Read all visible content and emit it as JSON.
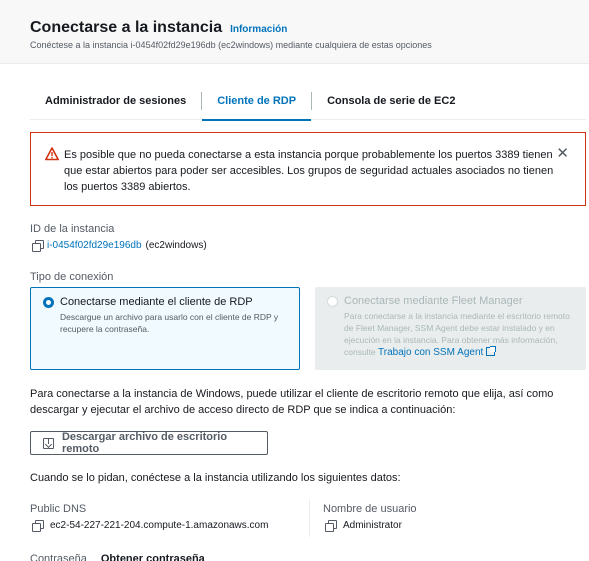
{
  "header": {
    "title": "Conectarse a la instancia",
    "info_link": "Información",
    "subtitle": "Conéctese a la instancia i-0454f02fd29e196db (ec2windows) mediante cualquiera de estas opciones"
  },
  "tabs": [
    {
      "label": "Administrador de sesiones",
      "active": false
    },
    {
      "label": "Cliente de RDP",
      "active": true
    },
    {
      "label": "Consola de serie de EC2",
      "active": false
    }
  ],
  "alert": {
    "text": "Es posible que no pueda conectarse a esta instancia porque probablemente los puertos 3389 tienen que estar abiertos para poder ser accesibles. Los grupos de seguridad actuales asociados no tienen los puertos 3389 abiertos.",
    "close_icon": "close-icon",
    "warning_icon": "warning-icon"
  },
  "instance": {
    "label": "ID de la instancia",
    "id": "i-0454f02fd29e196db",
    "name": "(ec2windows)"
  },
  "connection_type": {
    "label": "Tipo de conexión",
    "options": [
      {
        "title": "Conectarse mediante el cliente de RDP",
        "description": "Descargue un archivo para usarlo con el cliente de RDP y recupere la contraseña.",
        "selected": true,
        "disabled": false
      },
      {
        "title": "Conectarse mediante Fleet Manager",
        "description": "Para conectarse a la instancia mediante el escritorio remoto de Fleet Manager, SSM Agent debe estar instalado y en ejecución en la instancia. Para obtener más información, consulte",
        "link": "Trabajo con SSM Agent",
        "selected": false,
        "disabled": true
      }
    ]
  },
  "description": "Para conectarse a la instancia de Windows, puede utilizar el cliente de escritorio remoto que elija, así como descargar y ejecutar el archivo de acceso directo de RDP que se indica a continuación:",
  "download_button": "Descargar archivo de escritorio remoto",
  "credentials_intro": "Cuando se lo pidan, conéctese a la instancia utilizando los siguientes datos:",
  "public_dns": {
    "label": "Public DNS",
    "value": "ec2-54-227-221-204.compute-1.amazonaws.com"
  },
  "username": {
    "label": "Nombre de usuario",
    "value": "Administrator"
  },
  "password": {
    "label": "Contraseña",
    "action": "Obtener contraseña"
  },
  "colors": {
    "accent": "#0073bb",
    "error": "#d13212",
    "text": "#16191f",
    "muted": "#545b64"
  }
}
